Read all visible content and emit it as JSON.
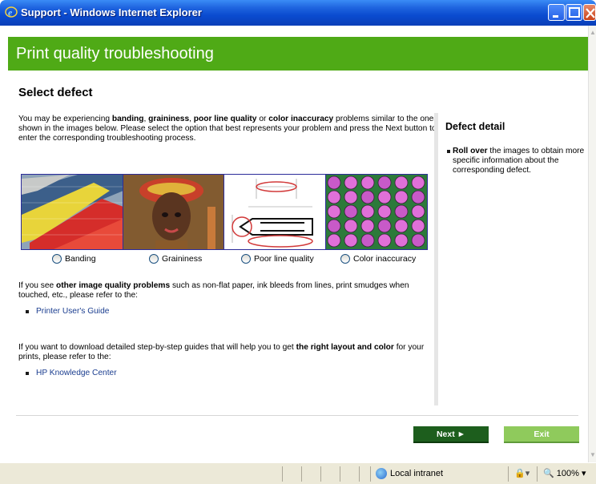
{
  "window": {
    "title": "Support - Windows Internet Explorer"
  },
  "banner": {
    "title": "Print quality troubleshooting"
  },
  "section": {
    "title": "Select defect"
  },
  "intro": {
    "t1": "You may be experiencing ",
    "b1": "banding",
    "t2": ", ",
    "b2": "graininess",
    "t3": ", ",
    "b3": "poor line quality",
    "t4": " or ",
    "b4": "color inaccuracy",
    "t5": " problems similar to the ones shown in the images below. Please select the option that best represents your problem and press the Next button to enter the corresponding troubleshooting process."
  },
  "options": [
    {
      "label": "Banding"
    },
    {
      "label": "Graininess"
    },
    {
      "label": "Poor line quality"
    },
    {
      "label": "Color inaccuracy"
    }
  ],
  "other": {
    "t1": "If you see ",
    "b1": "other image quality problems",
    "t2": " such as non-flat paper, ink bleeds from lines, print smudges when touched, etc., please refer to the:",
    "link": "Printer User's Guide"
  },
  "download": {
    "t1": "If you want to download detailed step-by-step guides that will help you to get ",
    "b1": "the right layout and color",
    "t2": " for your prints, please refer to the:",
    "link": "HP Knowledge Center"
  },
  "sidebar": {
    "title": "Defect detail",
    "b1": "Roll over",
    "t1": " the images to obtain more specific information about the corresponding defect."
  },
  "buttons": {
    "next": "Next ►",
    "exit": "Exit"
  },
  "status": {
    "zone": "Local intranet",
    "zoom": "100%"
  },
  "colors": {
    "banner": "#4faa16",
    "next": "#1d5e1d",
    "exit": "#8fca5c",
    "link": "#1a3d8f"
  }
}
